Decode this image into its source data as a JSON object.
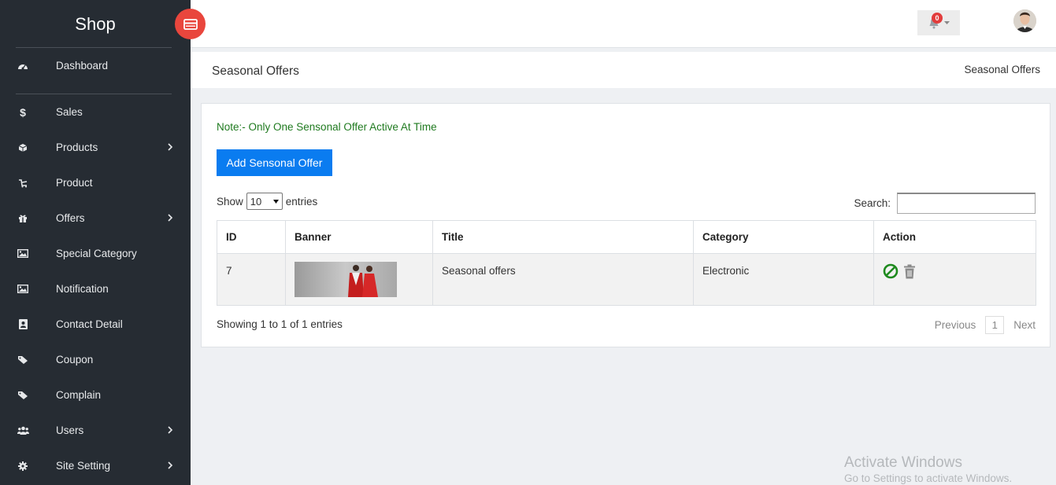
{
  "brand": "Shop",
  "sidebar": {
    "items": [
      {
        "label": "Dashboard",
        "icon": "dashboard-icon",
        "chevron": false
      },
      {
        "label": "Sales",
        "icon": "dollar-icon",
        "chevron": false
      },
      {
        "label": "Products",
        "icon": "cube-icon",
        "chevron": true
      },
      {
        "label": "Product",
        "icon": "product-icon",
        "chevron": false
      },
      {
        "label": "Offers",
        "icon": "gift-icon",
        "chevron": true
      },
      {
        "label": "Special Category",
        "icon": "image-icon",
        "chevron": false
      },
      {
        "label": "Notification",
        "icon": "image-icon",
        "chevron": false
      },
      {
        "label": "Contact Detail",
        "icon": "contact-icon",
        "chevron": false
      },
      {
        "label": "Coupon",
        "icon": "tag-icon",
        "chevron": false
      },
      {
        "label": "Complain",
        "icon": "tag-icon",
        "chevron": false
      },
      {
        "label": "Users",
        "icon": "users-icon",
        "chevron": true
      },
      {
        "label": "Site Setting",
        "icon": "gear-icon",
        "chevron": true
      }
    ]
  },
  "topbar": {
    "notification_count": "0"
  },
  "page": {
    "title": "Seasonal Offers",
    "breadcrumb": "Seasonal Offers"
  },
  "card": {
    "note": "Note:- Only One Sensonal Offer Active At Time",
    "add_button": "Add Sensonal Offer",
    "show_label": "Show",
    "entries_label": "entries",
    "page_length": "10",
    "search_label": "Search:",
    "search_value": ""
  },
  "table": {
    "columns": [
      "ID",
      "Banner",
      "Title",
      "Category",
      "Action"
    ],
    "rows": [
      {
        "id": "7",
        "title": "Seasonal offers",
        "category": "Electronic"
      }
    ]
  },
  "footer": {
    "showing": "Showing 1 to 1 of 1 entries",
    "previous": "Previous",
    "page": "1",
    "next": "Next"
  },
  "watermark": {
    "line1": "Activate Windows",
    "line2": "Go to Settings to activate Windows."
  },
  "colors": {
    "sidebar": "#262c33",
    "accent": "#0a7cf0",
    "toggle": "#e9463d",
    "note": "#1f7a1f"
  }
}
